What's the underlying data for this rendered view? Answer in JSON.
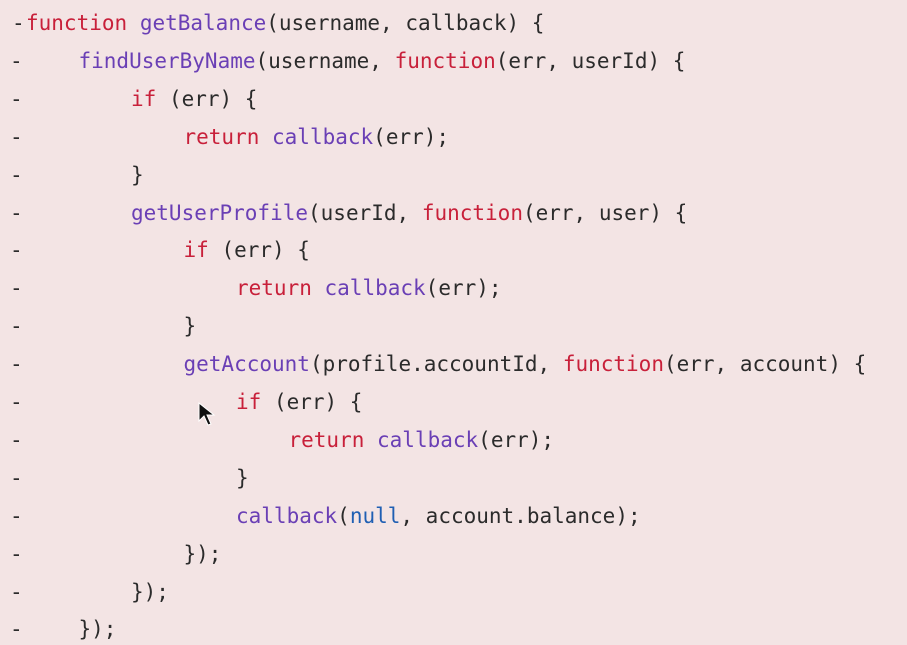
{
  "diff": {
    "marker": "-",
    "lines": [
      {
        "indent": 0,
        "tokens": [
          {
            "k": "kw",
            "t": "function"
          },
          {
            "k": "plain",
            "t": " "
          },
          {
            "k": "fn",
            "t": "getBalance"
          },
          {
            "k": "plain",
            "t": "(username, callback) {"
          }
        ]
      },
      {
        "indent": 1,
        "tokens": [
          {
            "k": "fn",
            "t": "findUserByName"
          },
          {
            "k": "plain",
            "t": "(username, "
          },
          {
            "k": "kw",
            "t": "function"
          },
          {
            "k": "plain",
            "t": "(err, userId) {"
          }
        ]
      },
      {
        "indent": 2,
        "tokens": [
          {
            "k": "kw",
            "t": "if"
          },
          {
            "k": "plain",
            "t": " (err) {"
          }
        ]
      },
      {
        "indent": 3,
        "tokens": [
          {
            "k": "kw",
            "t": "return"
          },
          {
            "k": "plain",
            "t": " "
          },
          {
            "k": "fn",
            "t": "callback"
          },
          {
            "k": "plain",
            "t": "(err);"
          }
        ]
      },
      {
        "indent": 2,
        "tokens": [
          {
            "k": "plain",
            "t": "}"
          }
        ]
      },
      {
        "indent": 2,
        "tokens": [
          {
            "k": "fn",
            "t": "getUserProfile"
          },
          {
            "k": "plain",
            "t": "(userId, "
          },
          {
            "k": "kw",
            "t": "function"
          },
          {
            "k": "plain",
            "t": "(err, user) {"
          }
        ]
      },
      {
        "indent": 3,
        "tokens": [
          {
            "k": "kw",
            "t": "if"
          },
          {
            "k": "plain",
            "t": " (err) {"
          }
        ]
      },
      {
        "indent": 4,
        "tokens": [
          {
            "k": "kw",
            "t": "return"
          },
          {
            "k": "plain",
            "t": " "
          },
          {
            "k": "fn",
            "t": "callback"
          },
          {
            "k": "plain",
            "t": "(err);"
          }
        ]
      },
      {
        "indent": 3,
        "tokens": [
          {
            "k": "plain",
            "t": "}"
          }
        ]
      },
      {
        "indent": 3,
        "tokens": [
          {
            "k": "fn",
            "t": "getAccount"
          },
          {
            "k": "plain",
            "t": "(profile.accountId, "
          },
          {
            "k": "kw",
            "t": "function"
          },
          {
            "k": "plain",
            "t": "(err, account) {"
          }
        ]
      },
      {
        "indent": 4,
        "tokens": [
          {
            "k": "kw",
            "t": "if"
          },
          {
            "k": "plain",
            "t": " (err) {"
          }
        ]
      },
      {
        "indent": 5,
        "tokens": [
          {
            "k": "kw",
            "t": "return"
          },
          {
            "k": "plain",
            "t": " "
          },
          {
            "k": "fn",
            "t": "callback"
          },
          {
            "k": "plain",
            "t": "(err);"
          }
        ]
      },
      {
        "indent": 4,
        "tokens": [
          {
            "k": "plain",
            "t": "}"
          }
        ]
      },
      {
        "indent": 4,
        "tokens": [
          {
            "k": "fn",
            "t": "callback"
          },
          {
            "k": "plain",
            "t": "("
          },
          {
            "k": "lit",
            "t": "null"
          },
          {
            "k": "plain",
            "t": ", account.balance);"
          }
        ]
      },
      {
        "indent": 3,
        "tokens": [
          {
            "k": "plain",
            "t": "});"
          }
        ]
      },
      {
        "indent": 2,
        "tokens": [
          {
            "k": "plain",
            "t": "});"
          }
        ]
      },
      {
        "indent": 1,
        "tokens": [
          {
            "k": "plain",
            "t": "});"
          }
        ]
      }
    ]
  },
  "colors": {
    "background": "#f3e4e4",
    "keyword": "#c8203a",
    "function": "#6a3fb5",
    "literal": "#1f5fb3",
    "text": "#2b2b2b"
  },
  "cursor_icon": "mouse-pointer-icon"
}
